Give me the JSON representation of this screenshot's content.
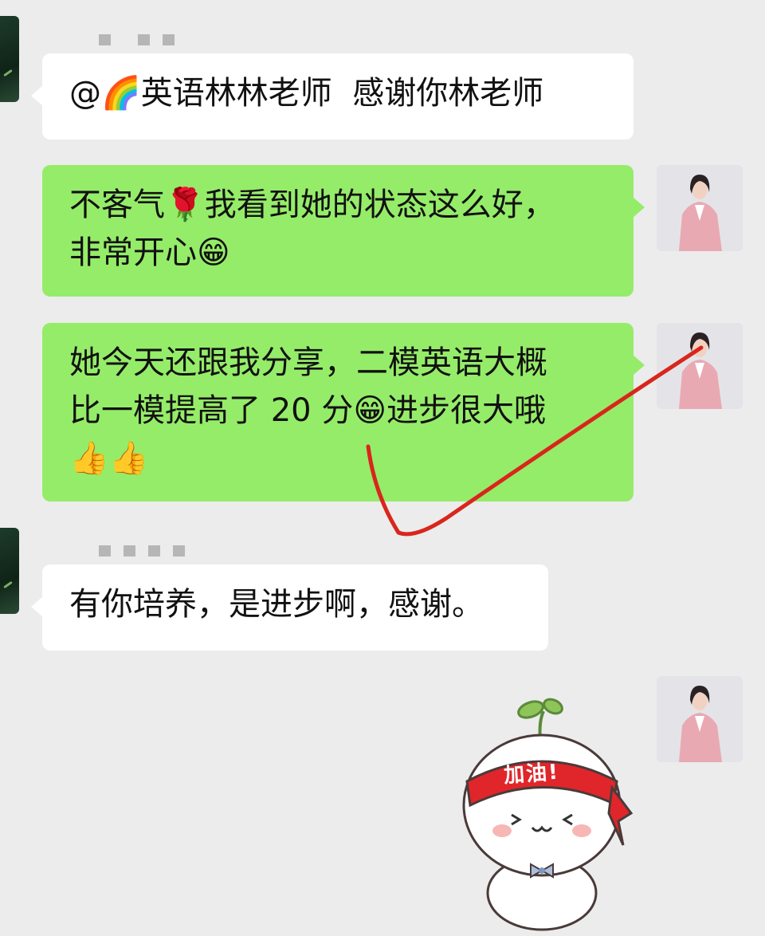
{
  "messages": [
    {
      "side": "left",
      "mention": "@🌈英语林林老师",
      "text": "感谢你林老师"
    },
    {
      "side": "right",
      "line1": "不客气🌹我看到她的状态这么好，",
      "line2": "非常开心😁"
    },
    {
      "side": "right",
      "line1": "她今天还跟我分享，二模英语大概",
      "line2": "比一模提高了 20 分😁进步很大哦",
      "line3": "👍👍"
    },
    {
      "side": "left",
      "text": "有你培养，是进步啊，感谢。"
    }
  ],
  "sticker": {
    "headband_text": "加油!"
  },
  "colors": {
    "background": "#ececec",
    "self_bubble": "#95ec69",
    "other_bubble": "#ffffff",
    "annotation_line": "#d9261c"
  }
}
